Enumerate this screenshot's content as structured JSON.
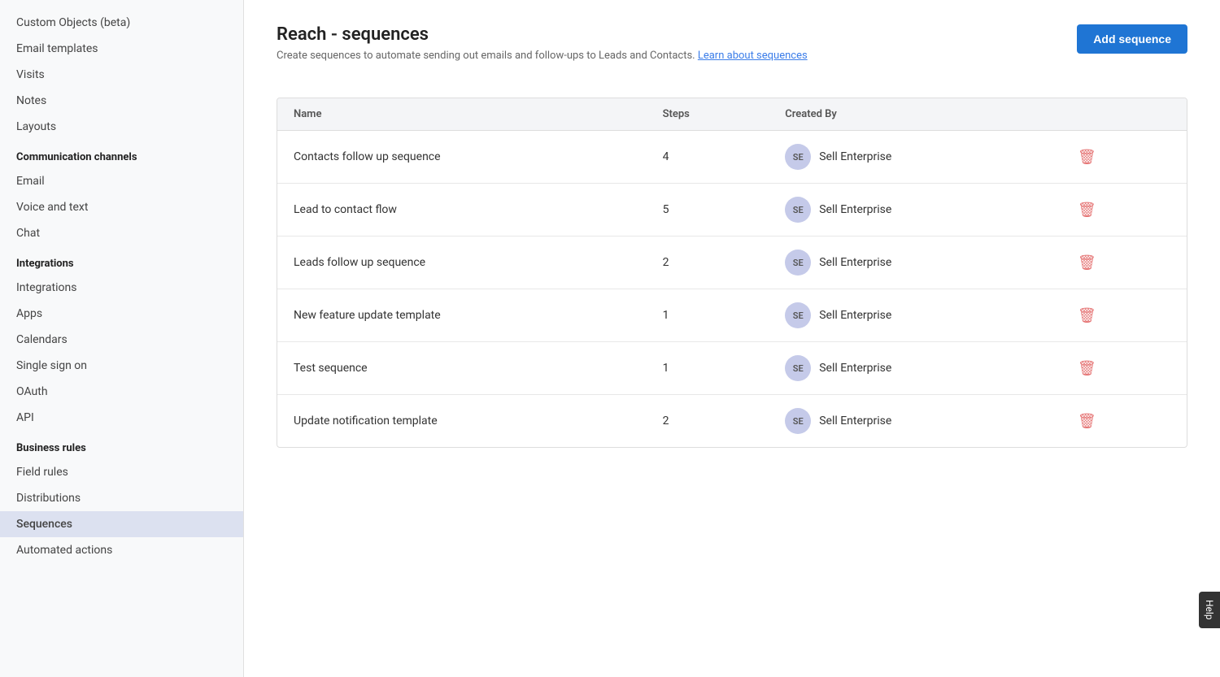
{
  "sidebar": {
    "items": [
      {
        "id": "custom-objects",
        "label": "Custom Objects (beta)",
        "active": false
      },
      {
        "id": "email-templates",
        "label": "Email templates",
        "active": false
      },
      {
        "id": "visits",
        "label": "Visits",
        "active": false
      },
      {
        "id": "notes",
        "label": "Notes",
        "active": false
      },
      {
        "id": "layouts",
        "label": "Layouts",
        "active": false
      }
    ],
    "sections": [
      {
        "id": "communication-channels",
        "label": "Communication channels",
        "items": [
          {
            "id": "email",
            "label": "Email",
            "active": false
          },
          {
            "id": "voice-and-text",
            "label": "Voice and text",
            "active": false
          },
          {
            "id": "chat",
            "label": "Chat",
            "active": false
          }
        ]
      },
      {
        "id": "integrations",
        "label": "Integrations",
        "items": [
          {
            "id": "integrations",
            "label": "Integrations",
            "active": false
          },
          {
            "id": "apps",
            "label": "Apps",
            "active": false
          },
          {
            "id": "calendars",
            "label": "Calendars",
            "active": false
          },
          {
            "id": "single-sign-on",
            "label": "Single sign on",
            "active": false
          },
          {
            "id": "oauth",
            "label": "OAuth",
            "active": false
          },
          {
            "id": "api",
            "label": "API",
            "active": false
          }
        ]
      },
      {
        "id": "business-rules",
        "label": "Business rules",
        "items": [
          {
            "id": "field-rules",
            "label": "Field rules",
            "active": false
          },
          {
            "id": "distributions",
            "label": "Distributions",
            "active": false
          },
          {
            "id": "sequences",
            "label": "Sequences",
            "active": true
          },
          {
            "id": "automated-actions",
            "label": "Automated actions",
            "active": false
          }
        ]
      }
    ]
  },
  "main": {
    "title": "Reach - sequences",
    "description": "Create sequences to automate sending out emails and follow-ups to Leads and Contacts.",
    "learn_link_text": "Learn about sequences",
    "add_button_label": "Add sequence",
    "table": {
      "headers": {
        "name": "Name",
        "steps": "Steps",
        "created_by": "Created By"
      },
      "rows": [
        {
          "id": 1,
          "name": "Contacts follow up sequence",
          "steps": "4",
          "avatar": "SE",
          "created_by": "Sell Enterprise"
        },
        {
          "id": 2,
          "name": "Lead to contact flow",
          "steps": "5",
          "avatar": "SE",
          "created_by": "Sell Enterprise"
        },
        {
          "id": 3,
          "name": "Leads follow up sequence",
          "steps": "2",
          "avatar": "SE",
          "created_by": "Sell Enterprise"
        },
        {
          "id": 4,
          "name": "New feature update template",
          "steps": "1",
          "avatar": "SE",
          "created_by": "Sell Enterprise"
        },
        {
          "id": 5,
          "name": "Test sequence",
          "steps": "1",
          "avatar": "SE",
          "created_by": "Sell Enterprise"
        },
        {
          "id": 6,
          "name": "Update notification template",
          "steps": "2",
          "avatar": "SE",
          "created_by": "Sell Enterprise"
        }
      ]
    }
  },
  "help": {
    "label": "Help"
  }
}
